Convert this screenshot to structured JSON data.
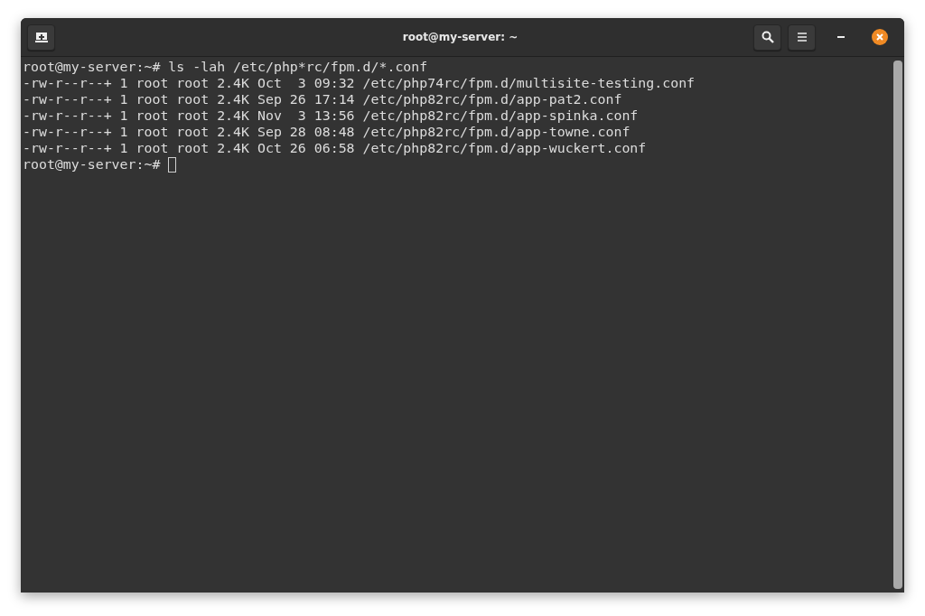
{
  "window": {
    "title": "root@my-server: ~"
  },
  "terminal": {
    "lines": [
      "root@my-server:~# ls -lah /etc/php*rc/fpm.d/*.conf",
      "-rw-r--r--+ 1 root root 2.4K Oct  3 09:32 /etc/php74rc/fpm.d/multisite-testing.conf",
      "-rw-r--r--+ 1 root root 2.4K Sep 26 17:14 /etc/php82rc/fpm.d/app-pat2.conf",
      "-rw-r--r--+ 1 root root 2.4K Nov  3 13:56 /etc/php82rc/fpm.d/app-spinka.conf",
      "-rw-r--r--+ 1 root root 2.4K Sep 28 08:48 /etc/php82rc/fpm.d/app-towne.conf",
      "-rw-r--r--+ 1 root root 2.4K Oct 26 06:58 /etc/php82rc/fpm.d/app-wuckert.conf"
    ],
    "prompt": "root@my-server:~#"
  }
}
